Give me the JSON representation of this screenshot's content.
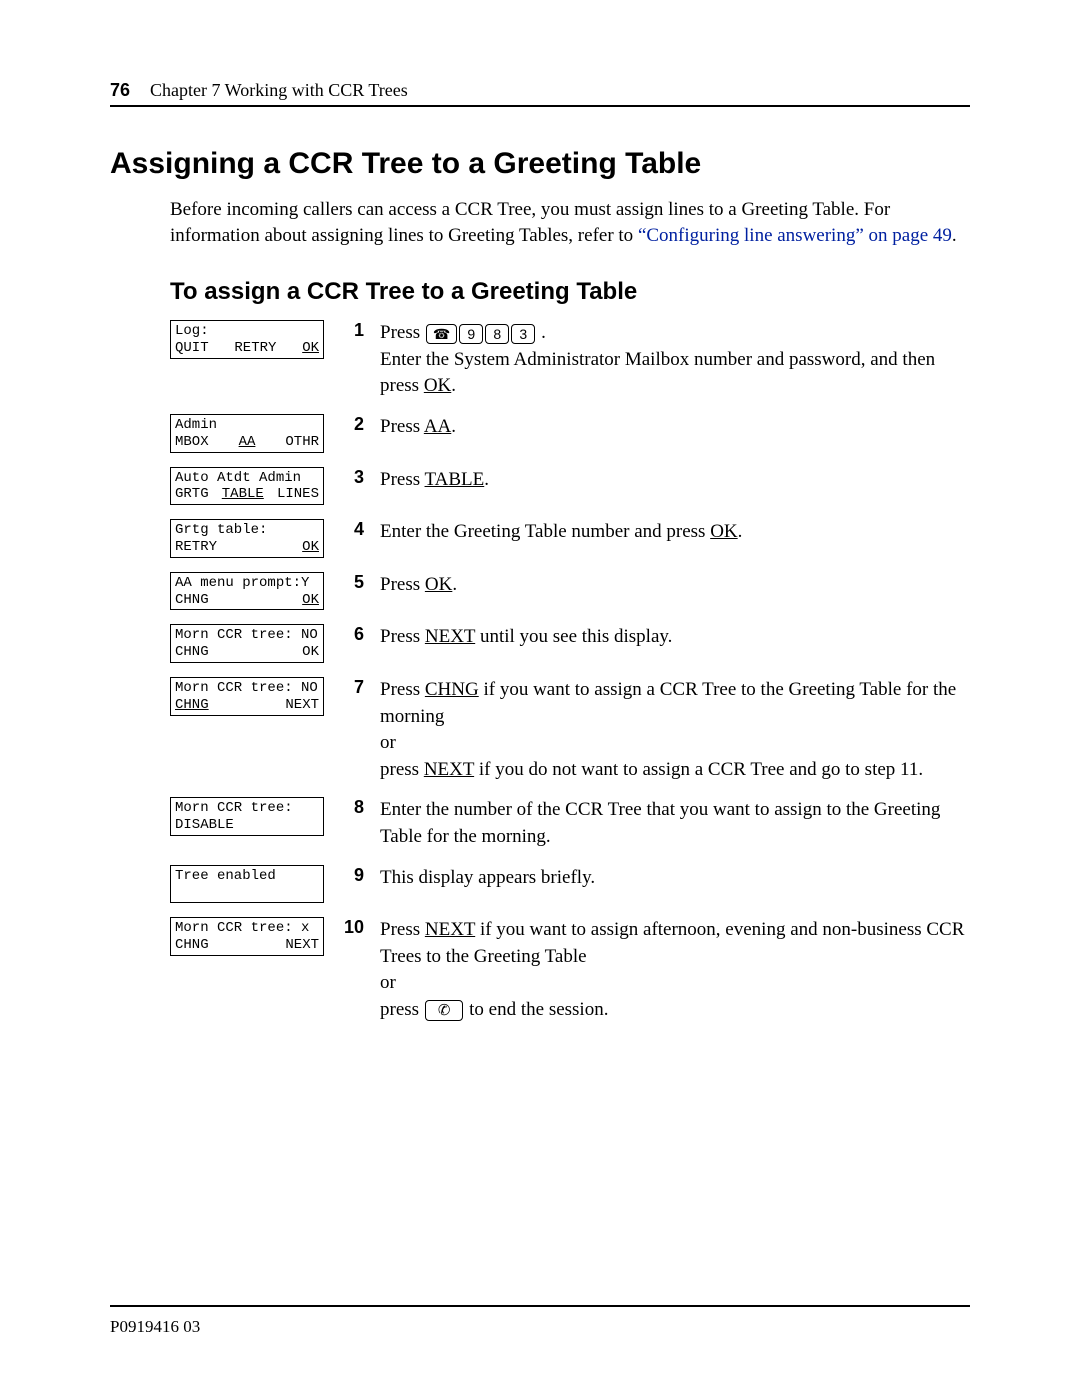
{
  "page_number": "76",
  "chapter": "Chapter 7  Working with CCR Trees",
  "title": "Assigning a CCR Tree to a Greeting Table",
  "intro_text_1": "Before incoming callers can access a CCR Tree, you must assign lines to a Greeting Table. For information about assigning lines to Greeting Tables, refer to ",
  "intro_link": "“Configuring line answering” on page 49",
  "intro_text_2": ".",
  "subtitle": "To assign a CCR Tree to a Greeting Table",
  "feature_key_glyph": "☎",
  "release_key_glyph": "⌕",
  "steps": [
    {
      "num": "1",
      "display": {
        "line1": "Log:",
        "sk1": "QUIT",
        "sk2": "RETRY",
        "sk3": "OK",
        "ul": [
          "sk3"
        ]
      },
      "text_pre": "Press ",
      "keys": [
        "9",
        "8",
        "3"
      ],
      "text_post": " .",
      "extra": "Enter the System Administrator Mailbox number and password, and then press ",
      "extra_ul": "OK",
      "extra_post": "."
    },
    {
      "num": "2",
      "display": {
        "line1": "Admin",
        "sk1": "MBOX",
        "sk2": "AA",
        "sk3": "OTHR",
        "ul": [
          "sk2"
        ]
      },
      "text_pre": "Press ",
      "text_ul": "AA",
      "text_post": "."
    },
    {
      "num": "3",
      "display": {
        "line1": "Auto Atdt Admin",
        "sk1": "GRTG",
        "sk2": "TABLE",
        "sk3": "LINES",
        "ul": [
          "sk2"
        ]
      },
      "text_pre": "Press ",
      "text_ul": "TABLE",
      "text_post": "."
    },
    {
      "num": "4",
      "display": {
        "line1": "Grtg table:",
        "sk1": "RETRY",
        "sk2": "",
        "sk3": "OK",
        "ul": [
          "sk3"
        ]
      },
      "text_pre": "Enter the Greeting Table number and press ",
      "text_ul": "OK",
      "text_post": "."
    },
    {
      "num": "5",
      "display": {
        "line1": "AA menu prompt:Y",
        "sk1": "CHNG",
        "sk2": "",
        "sk3": "OK",
        "ul": [
          "sk3"
        ]
      },
      "text_pre": "Press ",
      "text_ul": "OK",
      "text_post": "."
    },
    {
      "num": "6",
      "display": {
        "line1": "Morn CCR tree: NO",
        "sk1": "CHNG",
        "sk2": "",
        "sk3": "OK",
        "ul": []
      },
      "text_pre": "Press ",
      "text_ul": "NEXT",
      "text_post": " until you see this display."
    },
    {
      "num": "7",
      "display": {
        "line1": "Morn CCR tree: NO",
        "sk1": "CHNG",
        "sk2": "",
        "sk3": "NEXT",
        "ul": [
          "sk1"
        ]
      },
      "html": "Press <span class='ul'>CHNG</span> if you want to assign a CCR Tree to the Greeting Table for the morning<br>or<br>press <span class='ul'>NEXT</span> if you do not want to assign a CCR Tree and go to step 11."
    },
    {
      "num": "8",
      "display": {
        "line1": "Morn CCR tree:",
        "sk1": "DISABLE",
        "sk2": "",
        "sk3": "",
        "ul": []
      },
      "text_pre": "Enter the number of the CCR Tree that you want to assign to the Greeting Table for the morning."
    },
    {
      "num": "9",
      "display": {
        "line1": "Tree enabled",
        "sk1": "",
        "sk2": "",
        "sk3": "",
        "ul": []
      },
      "text_pre": "This display appears briefly."
    },
    {
      "num": "10",
      "display": {
        "line1": "Morn CCR tree: x",
        "sk1": "CHNG",
        "sk2": "",
        "sk3": "NEXT",
        "ul": []
      },
      "html": "Press <span class='ul'>NEXT</span> if you want to assign afternoon, evening and non-business CCR Trees to the Greeting Table<br>or<br>press <span class='key release'>✆</span> to end the session."
    }
  ],
  "doc_id": "P0919416 03"
}
